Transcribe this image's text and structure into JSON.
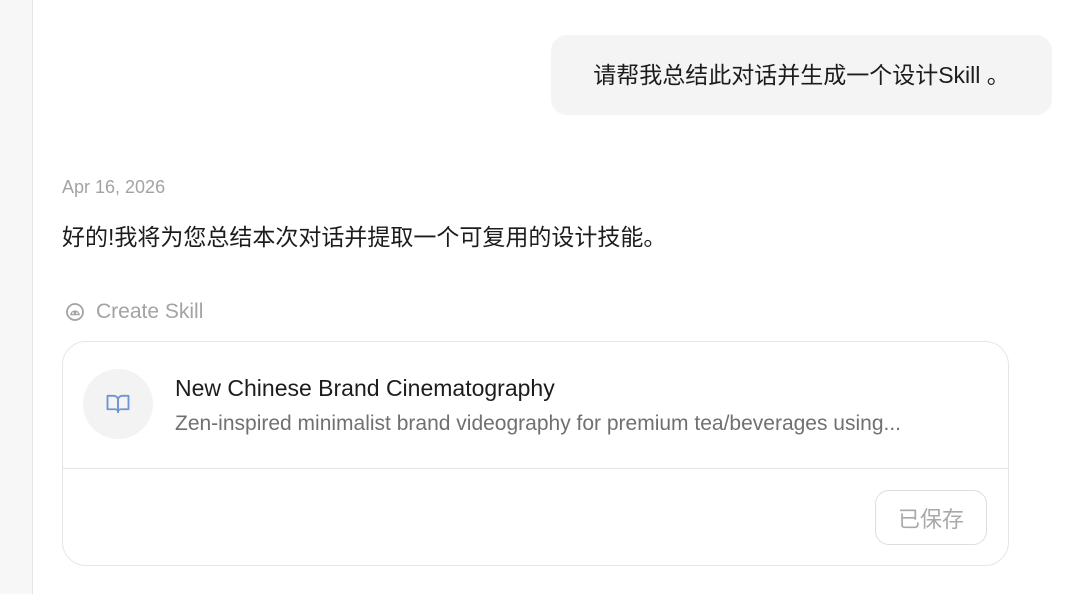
{
  "user_message": {
    "text": "请帮我总结此对话并生成一个设计Skill 。"
  },
  "assistant_message": {
    "date": "Apr 16, 2026",
    "text": "好的!我将为您总结本次对话并提取一个可复用的设计技能。",
    "tool_call": {
      "icon": "skill-icon",
      "label": "Create Skill"
    },
    "skill_card": {
      "icon": "book-icon",
      "title": "New Chinese Brand Cinematography",
      "description": "Zen-inspired minimalist brand videography for premium tea/beverages using...",
      "status_button_label": "已保存"
    }
  },
  "colors": {
    "accent": "#6f95d4",
    "bubble_bg": "#f4f4f4",
    "rail_bg": "#f7f7f7",
    "border": "#e6e6e6",
    "text_primary": "#1c1c1c",
    "text_secondary": "#707070",
    "text_muted": "#a3a3a3"
  }
}
